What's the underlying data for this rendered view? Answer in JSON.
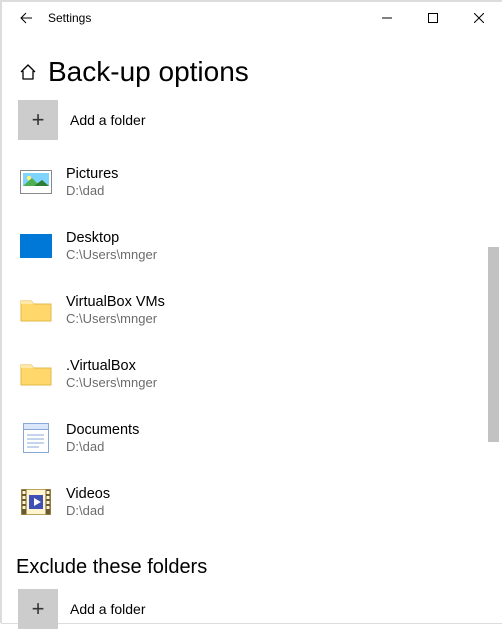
{
  "titlebar": {
    "title": "Settings"
  },
  "page": {
    "title": "Back-up options",
    "add_label": "Add a folder",
    "exclude_heading": "Exclude these folders",
    "exclude_add_label": "Add a folder"
  },
  "folders": [
    {
      "name": "Pictures",
      "path": "D:\\dad",
      "icon": "pictures"
    },
    {
      "name": "Desktop",
      "path": "C:\\Users\\mnger",
      "icon": "desktop"
    },
    {
      "name": "VirtualBox VMs",
      "path": "C:\\Users\\mnger",
      "icon": "folder"
    },
    {
      "name": ".VirtualBox",
      "path": "C:\\Users\\mnger",
      "icon": "folder"
    },
    {
      "name": "Documents",
      "path": "D:\\dad",
      "icon": "document"
    },
    {
      "name": "Videos",
      "path": "D:\\dad",
      "icon": "videos"
    }
  ]
}
